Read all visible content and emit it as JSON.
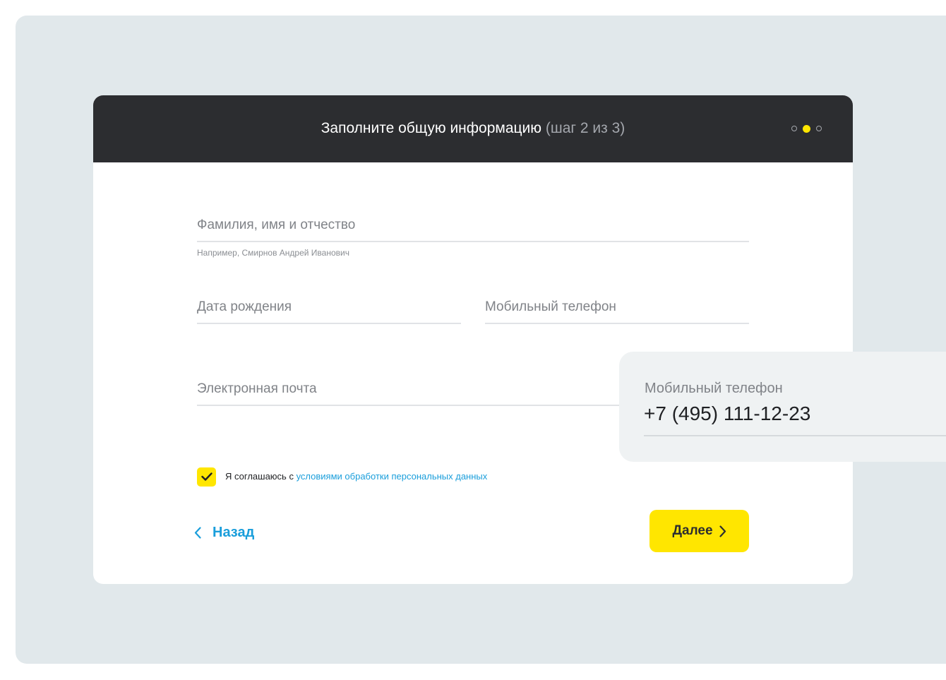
{
  "header": {
    "title": "Заполните общую информацию",
    "step": "(шаг 2 из 3)",
    "progress": {
      "current": 2,
      "total": 3
    }
  },
  "form": {
    "full_name": {
      "label": "Фамилия, имя и отчество",
      "hint": "Например, Смирнов Андрей Иванович"
    },
    "birth_date": {
      "label": "Дата рождения"
    },
    "mobile_phone": {
      "label": "Мобильный телефон"
    },
    "email": {
      "label": "Электронная почта"
    },
    "consent": {
      "checked": true,
      "text": "Я соглашаюсь с",
      "link": "условиями обработки персональных данных"
    },
    "back_label": "Назад",
    "next_label": "Далее"
  },
  "popout": {
    "label": "Мобильный телефон",
    "value": "+7 (495) 111-12-23"
  },
  "colors": {
    "accent": "#ffe600",
    "link": "#1a9edb",
    "header_bg": "#2c2d30",
    "backdrop": "#e1e8eb"
  },
  "icons": {
    "check": "check-icon",
    "back": "chevron-left-icon",
    "next": "chevron-right-icon"
  }
}
